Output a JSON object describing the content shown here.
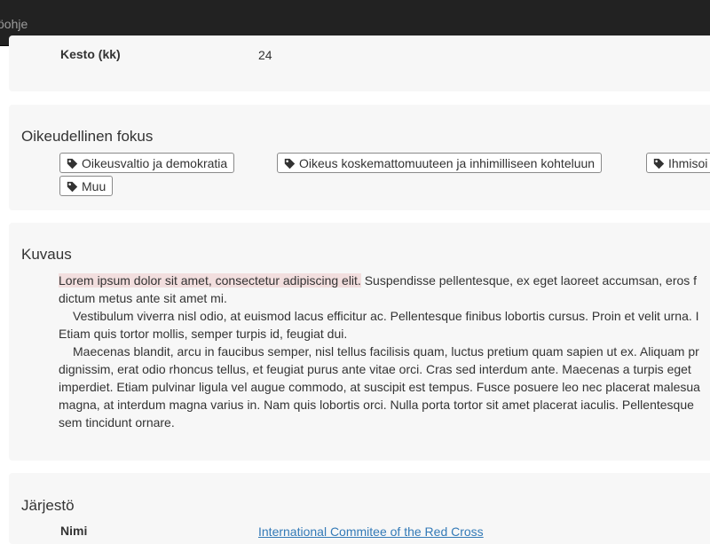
{
  "navbar": {
    "link_label": "öohje"
  },
  "details": {
    "duration_label": "Kesto (kk)",
    "duration_value": "24"
  },
  "legal_focus": {
    "heading": "Oikeudellinen fokus",
    "tags": [
      "Oikeusvaltio ja demokratia",
      "Oikeus koskemattomuuteen ja inhimilliseen kohteluun",
      "Ihmisoi",
      "Muu"
    ]
  },
  "description": {
    "heading": "Kuvaus",
    "highlighted": "Lorem ipsum dolor sit amet, consectetur adipiscing elit.",
    "p1_rest": " Suspendisse pellentesque, ex eget laoreet accumsan, eros f",
    "p1_line2": "dictum metus ante sit amet mi.",
    "p2_line1": "Vestibulum viverra nisl odio, at euismod lacus efficitur ac. Pellentesque finibus lobortis cursus. Proin et velit urna. I",
    "p2_line2": "Etiam quis tortor mollis, semper turpis id, feugiat dui.",
    "p3_line1": "Maecenas blandit, arcu in faucibus semper, nisl tellus facilisis quam, luctus pretium quam sapien ut ex. Aliquam pr",
    "p3_line2": "dignissim, erat odio rhoncus tellus, et feugiat purus ante vitae orci. Cras sed interdum ante. Maecenas a turpis eget",
    "p3_line3": "imperdiet. Etiam pulvinar ligula vel augue commodo, at suscipit est tempus. Fusce posuere leo nec placerat malesua",
    "p3_line4": "magna, at interdum magna varius in. Nam quis lobortis orci. Nulla porta tortor sit amet placerat iaculis. Pellentesque",
    "p3_line5": "sem tincidunt ornare."
  },
  "organization": {
    "heading": "Järjestö",
    "name_label": "Nimi",
    "name_value": "International Commitee of the Red Cross"
  },
  "icons": {
    "tag": "tag-icon"
  }
}
